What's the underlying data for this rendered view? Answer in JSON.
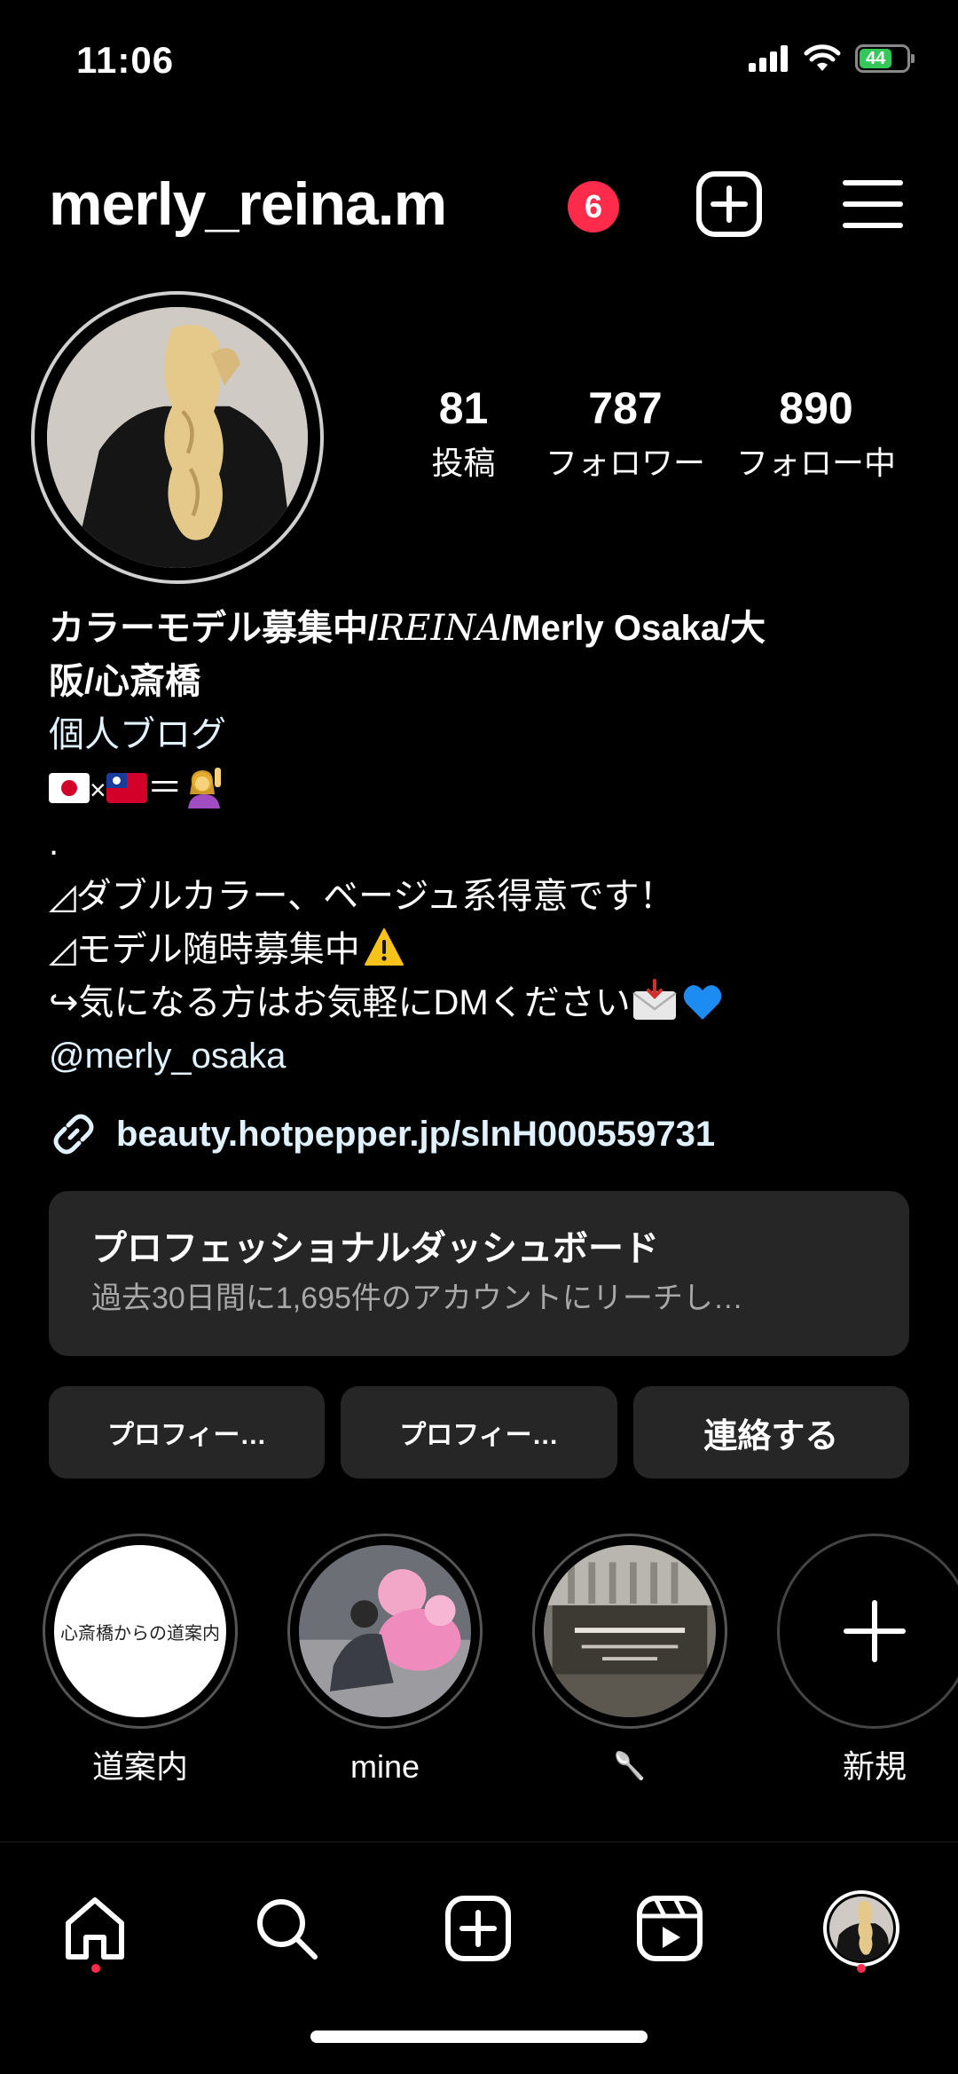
{
  "status_bar": {
    "time": "11:06",
    "battery": "44"
  },
  "header": {
    "username": "merly_reina.m",
    "notification_count": "6"
  },
  "stats": [
    {
      "value": "81",
      "label": "投稿"
    },
    {
      "value": "787",
      "label": "フォロワー"
    },
    {
      "value": "890",
      "label": "フォロー中"
    }
  ],
  "bio": {
    "name_line1_a": "カラーモデル募集中/",
    "name_line1_b": "REINA",
    "name_line1_c": "/Merly Osaka/大",
    "name_line2": "阪/心斎橋",
    "category": "個人ブログ",
    "flag_line_x": "×",
    "flag_line_eq": "＝",
    "dot": ".",
    "line1": "◿ダブルカラー、ベージュ系得意です！",
    "line2": "◿モデル随時募集中",
    "line3": "↪気になる方はお気軽にDMください",
    "mention": "@merly_osaka"
  },
  "link": {
    "url": "beauty.hotpepper.jp/slnH000559731"
  },
  "dashboard": {
    "title": "プロフェッショナルダッシュボード",
    "subtitle": "過去30日間に1,695件のアカウントにリーチし…"
  },
  "buttons": {
    "edit_profile": "プロフィー…",
    "share_profile": "プロフィー…",
    "contact": "連絡する"
  },
  "highlights": [
    {
      "label": "道案内",
      "cover_text": "心斎橋からの道案内"
    },
    {
      "label": "mine"
    },
    {
      "label": "🥄"
    },
    {
      "label": "新規"
    }
  ],
  "colors": {
    "background": "#000000",
    "card": "#262626",
    "badge": "#ff2b4a",
    "link": "#e0f1ff"
  }
}
